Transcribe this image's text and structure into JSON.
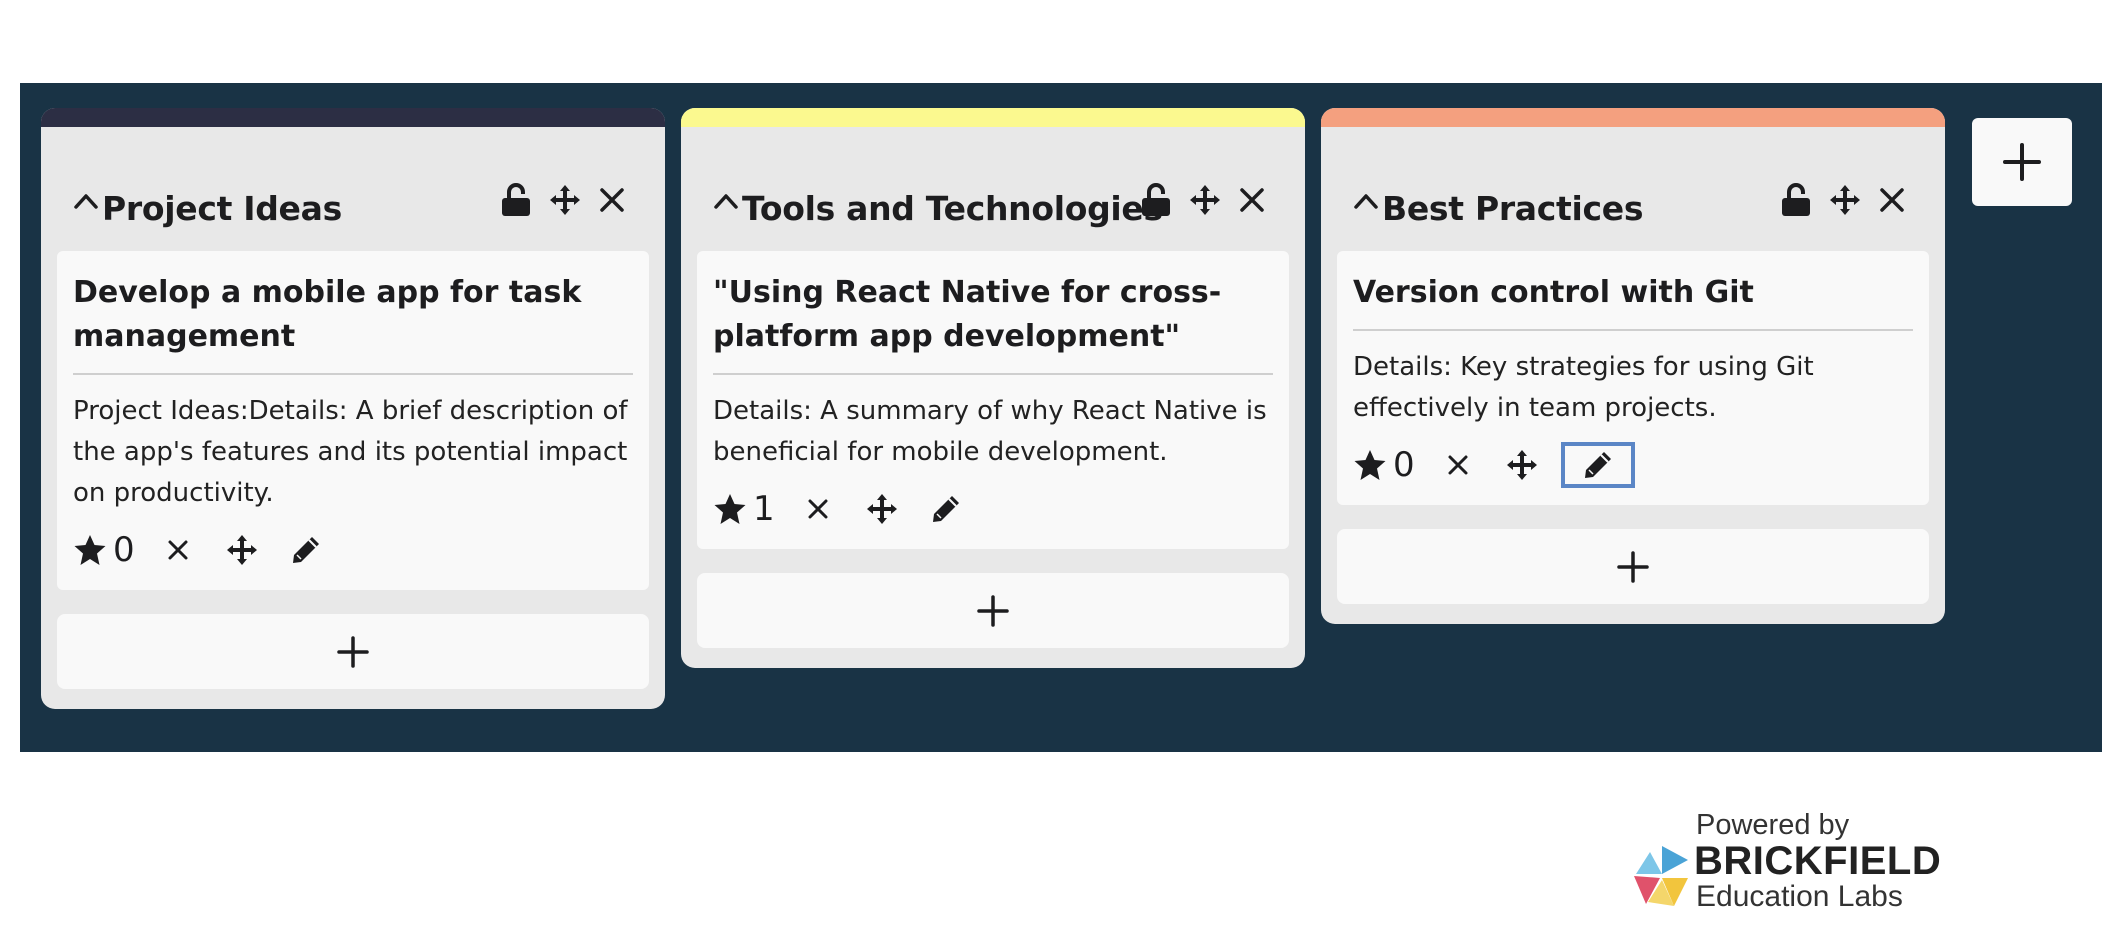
{
  "columns": [
    {
      "title": "Project Ideas",
      "stripe_color": "#2c2e44",
      "cards": [
        {
          "title": "Develop a mobile app for task management",
          "details": "Project Ideas:Details: A brief description of the app's features and its potential impact on productivity.",
          "stars": "0"
        }
      ]
    },
    {
      "title": "Tools and Technologies",
      "stripe_color": "#fbf98f",
      "cards": [
        {
          "title": "\"Using React Native for cross-platform app development\"",
          "details": "Details: A summary of why React Native is beneficial for mobile development.",
          "stars": "1"
        }
      ]
    },
    {
      "title": "Best Practices",
      "stripe_color": "#f4a07f",
      "cards": [
        {
          "title": "Version control with Git",
          "details": "Details: Key strategies for using Git effectively in team projects.",
          "stars": "0"
        }
      ]
    }
  ],
  "icons": {
    "collapse": "chevron-up-icon",
    "lock": "unlock-icon",
    "move": "move-icon",
    "delete": "close-icon",
    "star": "star-icon",
    "edit": "pencil-icon",
    "add": "plus-icon"
  },
  "colors": {
    "board_background": "#193345",
    "column_background": "#e8e8e8",
    "card_background": "#f9f9f9",
    "focus_ring": "#5b86c6"
  },
  "branding": {
    "powered_by": "Powered by",
    "name": "BRICKFIELD",
    "subtitle": "Education Labs"
  }
}
